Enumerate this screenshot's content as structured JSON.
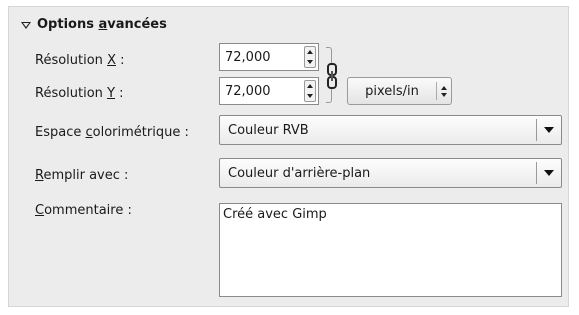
{
  "section": {
    "title_pre": "Options ",
    "title_u": "a",
    "title_post": "vancées"
  },
  "resolution_x": {
    "label_pre": "Résolution ",
    "label_u": "X",
    "label_post": " :",
    "value": "72,000"
  },
  "resolution_y": {
    "label_pre": "Résolution ",
    "label_u": "Y",
    "label_post": " :",
    "value": "72,000"
  },
  "unit": {
    "value": "pixels/in"
  },
  "colorspace": {
    "label_pre": "Espace ",
    "label_u": "c",
    "label_post": "olorimétrique :",
    "value": "Couleur RVB"
  },
  "fill": {
    "label_pre": "",
    "label_u": "R",
    "label_post": "emplir avec :",
    "value": "Couleur d'arrière-plan"
  },
  "comment": {
    "label_pre": "",
    "label_u": "C",
    "label_post": "ommentaire :",
    "value": "Créé avec Gimp"
  },
  "icons": {
    "expander": "triangle-down-icon",
    "chain": "chain-link-icon",
    "spin": "spin-arrows-icon",
    "dropdown": "dropdown-arrow-icon"
  }
}
